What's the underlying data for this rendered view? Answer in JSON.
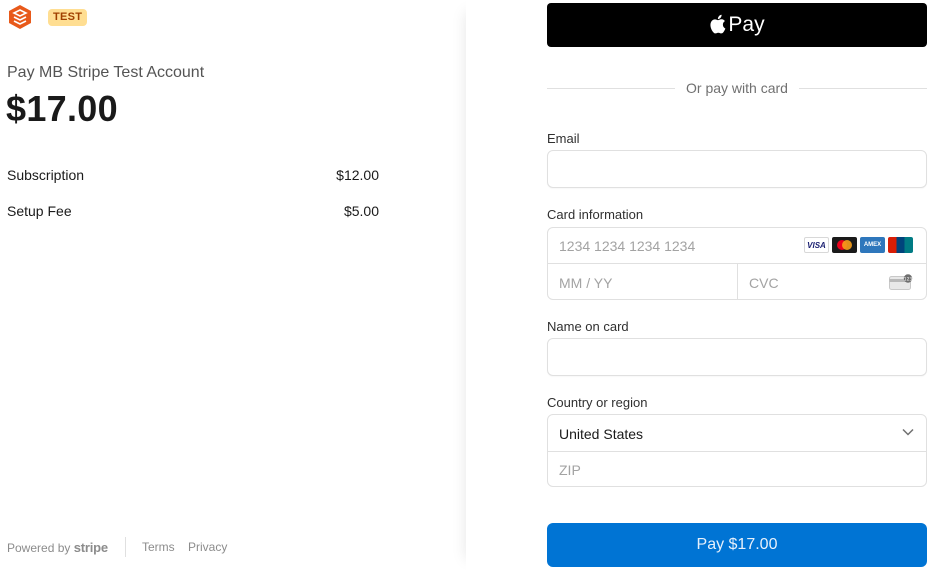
{
  "header": {
    "logo_icon": "stacked-layers-icon",
    "badge": "TEST",
    "brand_color": "#e8591a"
  },
  "summary": {
    "merchant_name": "Pay MB Stripe Test Account",
    "total": "$17.00",
    "line_items": [
      {
        "name": "Subscription",
        "price": "$12.00"
      },
      {
        "name": "Setup Fee",
        "price": "$5.00"
      }
    ]
  },
  "footer": {
    "powered_by": "Powered by",
    "stripe_word": "stripe",
    "terms": "Terms",
    "privacy": "Privacy"
  },
  "payment": {
    "apple_pay_label": "Pay",
    "divider_text": "Or pay with card",
    "email": {
      "label": "Email",
      "value": ""
    },
    "card": {
      "label": "Card information",
      "number_placeholder": "1234 1234 1234 1234",
      "expiry_placeholder": "MM / YY",
      "cvc_placeholder": "CVC",
      "brands": [
        "VISA",
        "mastercard",
        "AMEX",
        "UnionPay"
      ]
    },
    "name": {
      "label": "Name on card",
      "value": ""
    },
    "country": {
      "label": "Country or region",
      "selected": "United States",
      "zip_placeholder": "ZIP"
    },
    "pay_button": "Pay $17.00",
    "pay_button_color": "#0074d4"
  }
}
